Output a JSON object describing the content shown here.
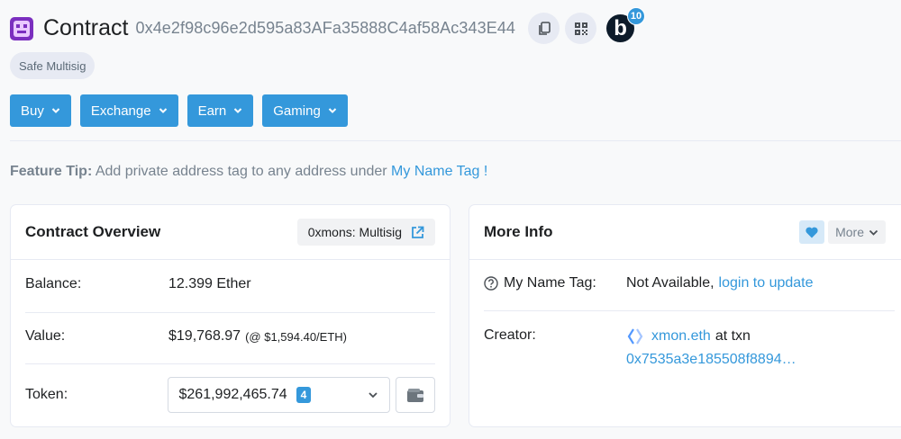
{
  "header": {
    "title": "Contract",
    "address": "0x4e2f98c96e2d595a83AFa35888C4af58Ac343E44",
    "blockscan_letter": "b",
    "blockscan_count": "10"
  },
  "badge": {
    "label": "Safe Multisig"
  },
  "actions": {
    "buy": "Buy",
    "exchange": "Exchange",
    "earn": "Earn",
    "gaming": "Gaming"
  },
  "tip": {
    "label": "Feature Tip:",
    "text": " Add private address tag to any address under ",
    "link": "My Name Tag !"
  },
  "overview": {
    "title": "Contract Overview",
    "tag": "0xmons: Multisig",
    "balance_label": "Balance:",
    "balance_value": "12.399 Ether",
    "value_label": "Value:",
    "value_amount": "$19,768.97",
    "value_rate": "(@ $1,594.40/ETH)",
    "token_label": "Token:",
    "token_value": "$261,992,465.74",
    "token_count": "4"
  },
  "more_info": {
    "title": "More Info",
    "more_label": "More",
    "name_tag_label": "My Name Tag:",
    "name_tag_value": "Not Available,",
    "name_tag_link": "login to update",
    "creator_label": "Creator:",
    "creator_name": "xmon.eth",
    "creator_at": "at txn",
    "creator_txn": "0x7535a3e185508f8894…"
  },
  "colors": {
    "accent": "#3498db",
    "text": "#1e2022",
    "muted": "#77838f",
    "border": "#e7eaf3"
  }
}
